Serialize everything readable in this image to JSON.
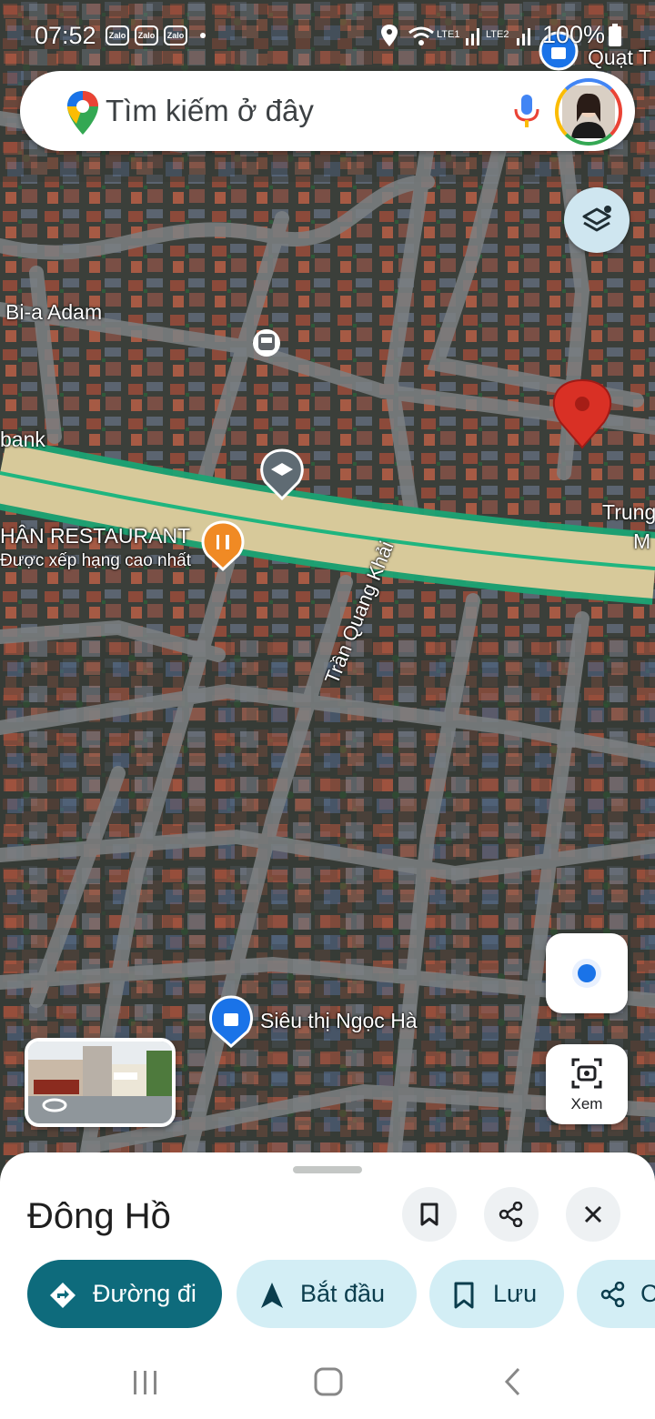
{
  "status_bar": {
    "time": "07:52",
    "zalo": [
      "Zalo",
      "Zalo",
      "Zalo"
    ],
    "sim1": "LTE1",
    "sim2": "LTE2",
    "battery": "100%"
  },
  "search": {
    "placeholder": "Tìm kiếm ở đây"
  },
  "map": {
    "labels": {
      "bia_adam": "Bi-a Adam",
      "bank": "bank",
      "restaurant": "HÂN RESTAURANT",
      "restaurant_sub": "Được xếp hạng cao nhất",
      "trung": "Trung",
      "m": "M",
      "quat": "Quạt T",
      "street": "Trần Quang Khải",
      "supermarket": "Siêu thị Ngọc Hà"
    }
  },
  "buttons": {
    "view_label": "Xem"
  },
  "place": {
    "title": "Đông Hồ"
  },
  "chips": {
    "directions": "Đường đi",
    "start": "Bắt đầu",
    "save": "Lưu",
    "share": "C"
  },
  "colors": {
    "accent": "#0e6b7c",
    "chip_bg": "#d3eef5",
    "pin": "#d93025",
    "locate_dot": "#1a73e8"
  }
}
